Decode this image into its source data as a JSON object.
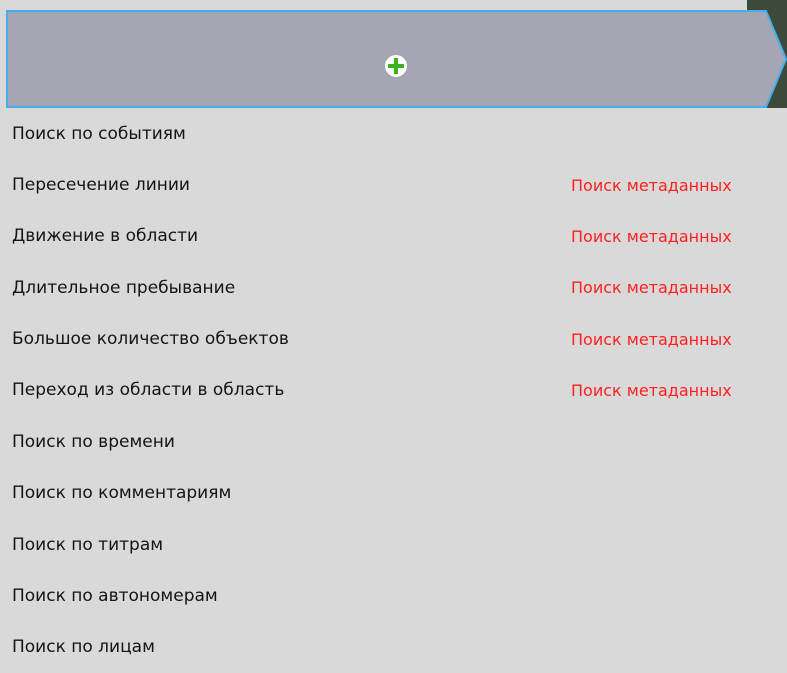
{
  "header": {
    "add_icon": "plus-circle-icon",
    "colors": {
      "tab_fill": "#a4a6b4",
      "tab_border": "#46aeea",
      "icon_circle": "#ffffff",
      "icon_plus": "#3cb21e",
      "background_dark": "#3c4a3c"
    }
  },
  "search_types": [
    {
      "label": "Поиск по событиям",
      "meta": ""
    },
    {
      "label": "Пересечение линии",
      "meta": "Поиск метаданных"
    },
    {
      "label": "Движение в области",
      "meta": "Поиск метаданных"
    },
    {
      "label": "Длительное пребывание",
      "meta": "Поиск метаданных"
    },
    {
      "label": "Большое количество объектов",
      "meta": "Поиск метаданных"
    },
    {
      "label": "Переход из области в область",
      "meta": "Поиск метаданных"
    },
    {
      "label": "Поиск по времени",
      "meta": ""
    },
    {
      "label": "Поиск по комментариям",
      "meta": ""
    },
    {
      "label": "Поиск по титрам",
      "meta": ""
    },
    {
      "label": "Поиск по автономерам",
      "meta": ""
    },
    {
      "label": "Поиск по лицам",
      "meta": ""
    }
  ],
  "colors": {
    "list_background": "#d9d9d9",
    "label_text": "#141414",
    "meta_text": "#ff2020"
  }
}
